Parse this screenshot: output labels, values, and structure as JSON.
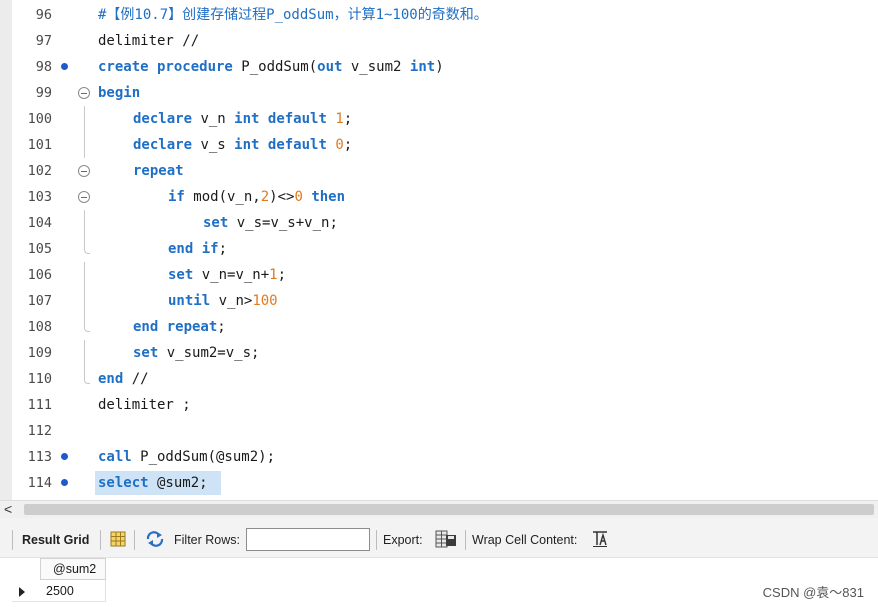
{
  "editor": {
    "lines": [
      {
        "number": "96",
        "marker": false,
        "fold": "none",
        "indent": 0,
        "tokens": [
          {
            "t": "#【例10.7】创建存储过程P_oddSum，计算1~100的奇数和。",
            "c": "cmt"
          }
        ]
      },
      {
        "number": "97",
        "marker": false,
        "fold": "none",
        "indent": 0,
        "tokens": [
          {
            "t": "delimiter //",
            "c": "txt"
          }
        ]
      },
      {
        "number": "98",
        "marker": true,
        "fold": "none",
        "indent": 0,
        "tokens": [
          {
            "t": "create procedure",
            "c": "kw"
          },
          {
            "t": " P_oddSum(",
            "c": "txt"
          },
          {
            "t": "out",
            "c": "kw"
          },
          {
            "t": " v_sum2 ",
            "c": "txt"
          },
          {
            "t": "int",
            "c": "kw"
          },
          {
            "t": ")",
            "c": "txt"
          }
        ]
      },
      {
        "number": "99",
        "marker": false,
        "fold": "open",
        "indent": 0,
        "tokens": [
          {
            "t": "begin",
            "c": "kw"
          }
        ]
      },
      {
        "number": "100",
        "marker": false,
        "fold": "line",
        "indent": 1,
        "tokens": [
          {
            "t": "declare",
            "c": "kw"
          },
          {
            "t": " v_n ",
            "c": "txt"
          },
          {
            "t": "int default",
            "c": "kw"
          },
          {
            "t": " ",
            "c": "txt"
          },
          {
            "t": "1",
            "c": "num"
          },
          {
            "t": ";",
            "c": "txt"
          }
        ]
      },
      {
        "number": "101",
        "marker": false,
        "fold": "line",
        "indent": 1,
        "tokens": [
          {
            "t": "declare",
            "c": "kw"
          },
          {
            "t": " v_s ",
            "c": "txt"
          },
          {
            "t": "int default",
            "c": "kw"
          },
          {
            "t": " ",
            "c": "txt"
          },
          {
            "t": "0",
            "c": "num"
          },
          {
            "t": ";",
            "c": "txt"
          }
        ]
      },
      {
        "number": "102",
        "marker": false,
        "fold": "open",
        "indent": 1,
        "tokens": [
          {
            "t": "repeat",
            "c": "kw"
          }
        ]
      },
      {
        "number": "103",
        "marker": false,
        "fold": "open",
        "indent": 2,
        "tokens": [
          {
            "t": "if",
            "c": "kw"
          },
          {
            "t": " mod(v_n,",
            "c": "txt"
          },
          {
            "t": "2",
            "c": "num"
          },
          {
            "t": ")<>",
            "c": "txt"
          },
          {
            "t": "0",
            "c": "num"
          },
          {
            "t": " ",
            "c": "txt"
          },
          {
            "t": "then",
            "c": "kw"
          }
        ]
      },
      {
        "number": "104",
        "marker": false,
        "fold": "line",
        "indent": 3,
        "tokens": [
          {
            "t": "set",
            "c": "kw"
          },
          {
            "t": " v_s=v_s+v_n;",
            "c": "txt"
          }
        ]
      },
      {
        "number": "105",
        "marker": false,
        "fold": "end",
        "indent": 2,
        "tokens": [
          {
            "t": "end if",
            "c": "kw"
          },
          {
            "t": ";",
            "c": "txt"
          }
        ]
      },
      {
        "number": "106",
        "marker": false,
        "fold": "line",
        "indent": 2,
        "tokens": [
          {
            "t": "set",
            "c": "kw"
          },
          {
            "t": " v_n=v_n+",
            "c": "txt"
          },
          {
            "t": "1",
            "c": "num"
          },
          {
            "t": ";",
            "c": "txt"
          }
        ]
      },
      {
        "number": "107",
        "marker": false,
        "fold": "line",
        "indent": 2,
        "tokens": [
          {
            "t": "until",
            "c": "kw"
          },
          {
            "t": " v_n>",
            "c": "txt"
          },
          {
            "t": "100",
            "c": "num"
          }
        ]
      },
      {
        "number": "108",
        "marker": false,
        "fold": "end",
        "indent": 1,
        "tokens": [
          {
            "t": "end repeat",
            "c": "kw"
          },
          {
            "t": ";",
            "c": "txt"
          }
        ]
      },
      {
        "number": "109",
        "marker": false,
        "fold": "line",
        "indent": 1,
        "tokens": [
          {
            "t": "set",
            "c": "kw"
          },
          {
            "t": " v_sum2=v_s;",
            "c": "txt"
          }
        ]
      },
      {
        "number": "110",
        "marker": false,
        "fold": "end",
        "indent": 0,
        "tokens": [
          {
            "t": "end",
            "c": "kw"
          },
          {
            "t": " //",
            "c": "txt"
          }
        ]
      },
      {
        "number": "111",
        "marker": false,
        "fold": "none",
        "indent": 0,
        "tokens": [
          {
            "t": "delimiter ;",
            "c": "txt"
          }
        ]
      },
      {
        "number": "112",
        "marker": false,
        "fold": "none",
        "indent": 0,
        "tokens": []
      },
      {
        "number": "113",
        "marker": true,
        "fold": "none",
        "indent": 0,
        "tokens": [
          {
            "t": "call",
            "c": "kw"
          },
          {
            "t": " P_oddSum(@sum2);",
            "c": "txt"
          }
        ]
      },
      {
        "number": "114",
        "marker": true,
        "fold": "none",
        "indent": 0,
        "selected": true,
        "tokens": [
          {
            "t": "select",
            "c": "kw"
          },
          {
            "t": " @sum2;",
            "c": "txt"
          }
        ]
      }
    ]
  },
  "scrollbar": {
    "left_arrow": "<"
  },
  "toolbar": {
    "result_grid_label": "Result Grid",
    "grid_icon": "grid-view-icon",
    "filter_icon": "filter-refresh-icon",
    "filter_label": "Filter Rows:",
    "filter_value": "",
    "export_label": "Export:",
    "export_icon": "export-icon",
    "wrap_label": "Wrap Cell Content:",
    "wrap_icon": "wrap-text-icon"
  },
  "result": {
    "columns": [
      "@sum2"
    ],
    "rows": [
      [
        "2500"
      ]
    ]
  },
  "watermark": "CSDN @袁～831",
  "colors": {
    "keyword": "#1f6fc5",
    "number": "#e07a1f",
    "selection": "#cfe3f7",
    "marker": "#1e5bc6"
  }
}
